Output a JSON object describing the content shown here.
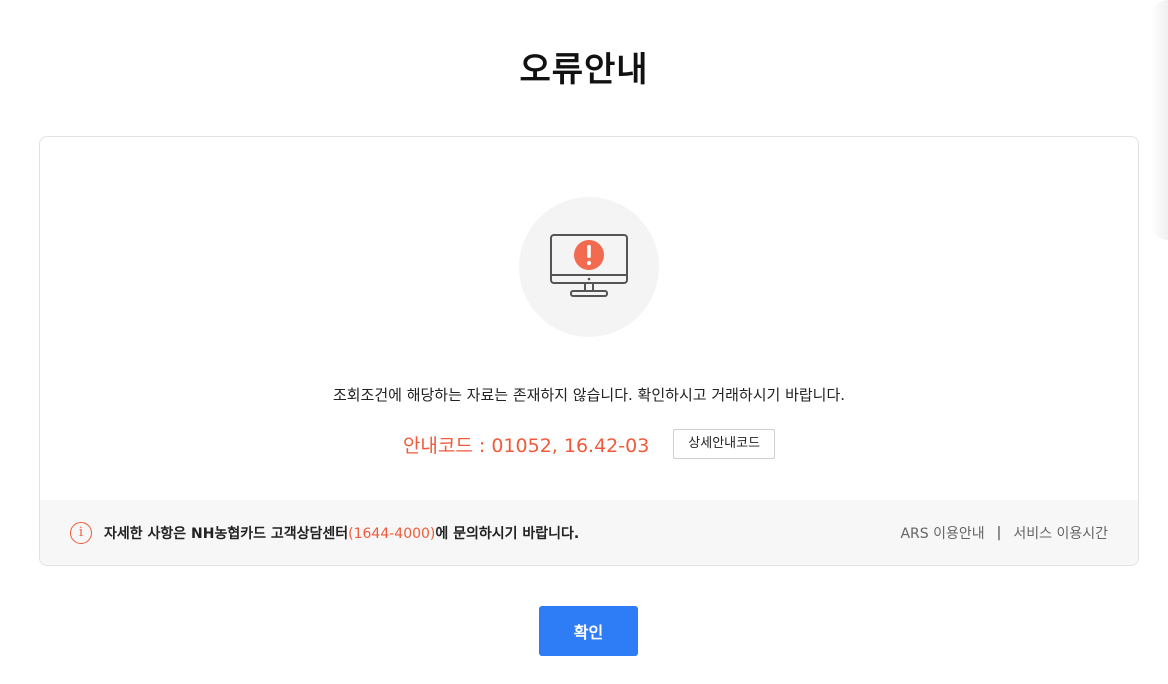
{
  "page": {
    "title": "오류안내"
  },
  "error": {
    "icon": "monitor-alert-icon",
    "message": "조회조건에 해당하는 자료는 존재하지 않습니다. 확인하시고 거래하시기 바랍니다.",
    "code_text": "안내코드 : 01052, 16.42-03",
    "detail_button_label": "상세안내코드"
  },
  "info_bar": {
    "icon": "info-icon",
    "icon_glyph": "i",
    "text_before": "자세한 사항은 NH농협카드 고객상담센터",
    "phone": "(1644-4000)",
    "text_after": "에 문의하시기 바랍니다.",
    "links": {
      "ars": "ARS 이용안내",
      "separator": "|",
      "service_hours": "서비스 이용시간"
    }
  },
  "footer": {
    "confirm_label": "확인"
  },
  "colors": {
    "accent_red": "#f15a3a",
    "primary_blue": "#2e7cf6"
  }
}
